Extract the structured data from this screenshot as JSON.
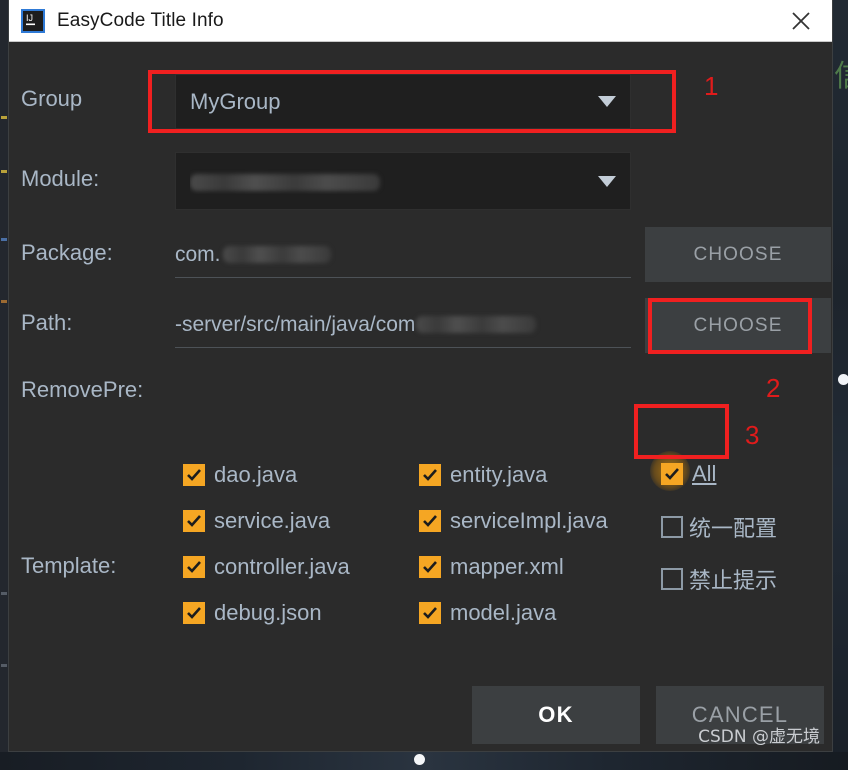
{
  "window": {
    "title": "EasyCode Title Info",
    "app_icon": "intellij-idea-icon",
    "close_icon": "close-icon"
  },
  "form": {
    "group": {
      "label": "Group",
      "value": "MyGroup",
      "arrow_icon": "chevron-down-icon"
    },
    "module": {
      "label": "Module:",
      "value": "",
      "value_redacted": true,
      "arrow_icon": "chevron-down-icon"
    },
    "package": {
      "label": "Package:",
      "value": "com.",
      "value_redacted": true,
      "button": "CHOOSE"
    },
    "path": {
      "label": "Path:",
      "value": "-server/src/main/java/com",
      "value_redacted": true,
      "button": "CHOOSE"
    },
    "remove_pre": {
      "label": "RemovePre:",
      "value": ""
    },
    "template": {
      "label": "Template:",
      "column_left": [
        {
          "label": "dao.java",
          "checked": true
        },
        {
          "label": "service.java",
          "checked": true
        },
        {
          "label": "controller.java",
          "checked": true
        },
        {
          "label": "debug.json",
          "checked": true
        }
      ],
      "column_middle": [
        {
          "label": "entity.java",
          "checked": true
        },
        {
          "label": "serviceImpl.java",
          "checked": true
        },
        {
          "label": "mapper.xml",
          "checked": true
        },
        {
          "label": "model.java",
          "checked": true
        }
      ],
      "column_right": [
        {
          "label": "All",
          "checked": true,
          "focused": true,
          "underlined": true
        },
        {
          "label": "统一配置",
          "checked": false
        },
        {
          "label": "禁止提示",
          "checked": false
        }
      ]
    }
  },
  "actions": {
    "ok": "OK",
    "cancel": "CANCEL"
  },
  "annotations": {
    "numbers": [
      "1",
      "2",
      "3"
    ],
    "highlight_color": "#f02020"
  },
  "watermark": "CSDN @虚无境",
  "background": {
    "ide_glyph": "信"
  }
}
